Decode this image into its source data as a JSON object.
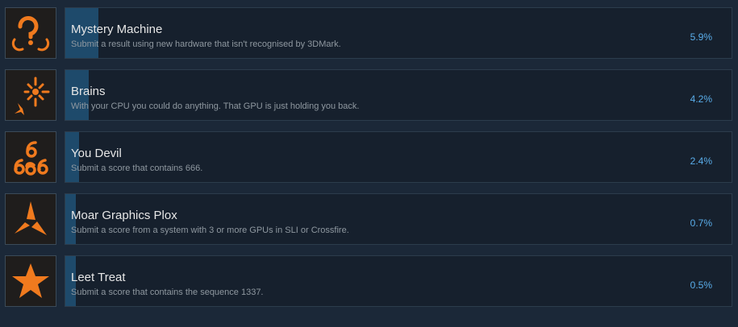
{
  "colors": {
    "background": "#1b2838",
    "panel": "#16202d",
    "progress_fill": "#1e4a6b",
    "icon_orange": "#f07a1e",
    "percent_text": "#5aaeeb"
  },
  "achievements": [
    {
      "icon": "question-mark-icon",
      "title": "Mystery Machine",
      "description": "Submit a result using new hardware that isn't recognised by 3DMark.",
      "percent": "5.9%",
      "progress": 5.9
    },
    {
      "icon": "brain-spark-icon",
      "title": "Brains",
      "description": "With your CPU you could do anything. That GPU is just holding you back.",
      "percent": "4.2%",
      "progress": 4.2
    },
    {
      "icon": "number-666-icon",
      "title": "You Devil",
      "description": "Submit a score that contains 666.",
      "percent": "2.4%",
      "progress": 2.4
    },
    {
      "icon": "tri-blade-icon",
      "title": "Moar Graphics Plox",
      "description": "Submit a score from a system with 3 or more GPUs in SLI or Crossfire.",
      "percent": "0.7%",
      "progress": 0.7
    },
    {
      "icon": "star-icon",
      "title": "Leet Treat",
      "description": "Submit a score that contains the sequence 1337.",
      "percent": "0.5%",
      "progress": 0.5
    }
  ]
}
